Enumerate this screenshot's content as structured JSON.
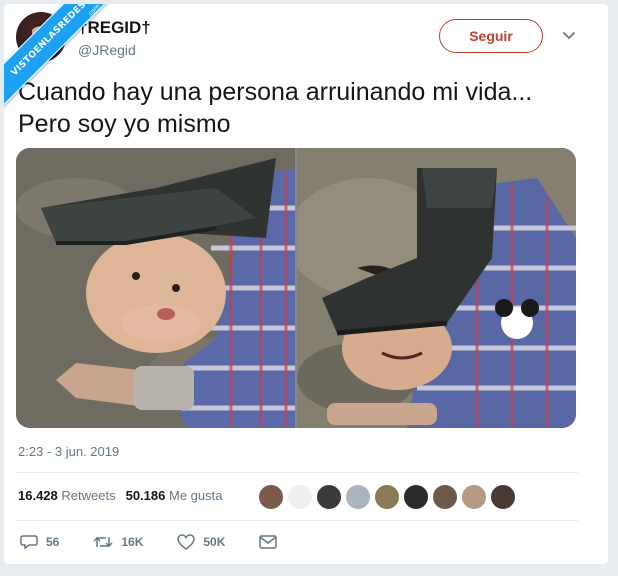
{
  "watermark": {
    "text": "VISTOENLASREDES",
    "sub": ".com"
  },
  "user": {
    "display_name": "†REGID†",
    "handle": "@JRegid",
    "avatar_icon": "avatar-photo"
  },
  "follow_button": {
    "label": "Seguir",
    "color": "#c0422f"
  },
  "tweet": {
    "text": "Cuando hay una persona arruinando mi vida... Pero soy yo mismo",
    "timestamp": "2:23 - 3 jun. 2019"
  },
  "stats": {
    "retweets_count": "16.428",
    "retweets_label": "Retweets",
    "likes_count": "50.186",
    "likes_label": "Me gusta"
  },
  "likers": [
    "#7a5a4a",
    "#e9e9e9",
    "#3a3a3a",
    "#aab4be",
    "#8a7a55",
    "#2b2b2b",
    "#6d5a48",
    "#b59b86",
    "#4a3a36"
  ],
  "actions": {
    "reply_count": "56",
    "retweet_count": "16K",
    "like_count": "50K"
  }
}
